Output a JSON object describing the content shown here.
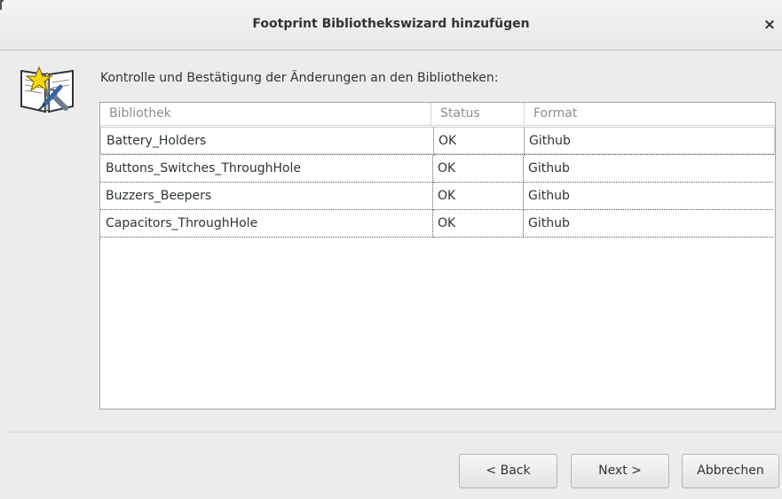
{
  "window": {
    "title": "Footprint Bibliothekswizard hinzufügen",
    "close_glyph": "×"
  },
  "page": {
    "instruction": "Kontrolle und Bestätigung der Änderungen an den Bibliotheken:",
    "icon": "wizard-book-icon"
  },
  "table": {
    "columns": [
      "Bibliothek",
      "Status",
      "Format"
    ],
    "rows": [
      {
        "library": "Battery_Holders",
        "status": "OK",
        "format": "Github"
      },
      {
        "library": "Buttons_Switches_ThroughHole",
        "status": "OK",
        "format": "Github"
      },
      {
        "library": "Buzzers_Beepers",
        "status": "OK",
        "format": "Github"
      },
      {
        "library": "Capacitors_ThroughHole",
        "status": "OK",
        "format": "Github"
      }
    ]
  },
  "buttons": {
    "back": "< Back",
    "next": "Next >",
    "cancel": "Abbrechen"
  }
}
